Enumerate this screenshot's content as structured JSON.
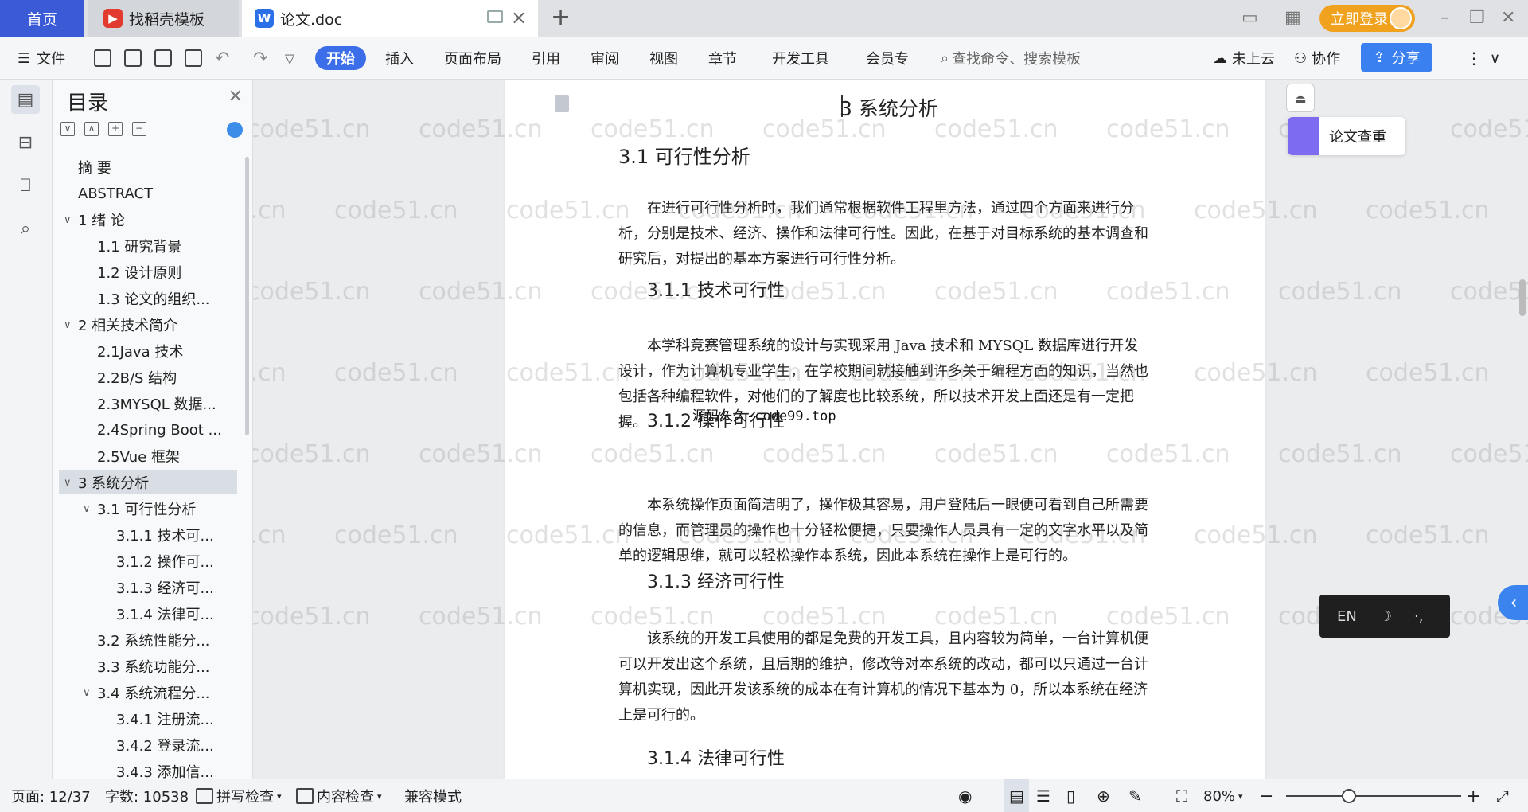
{
  "tabs": {
    "home": "首页",
    "template": "找稻壳模板",
    "doc": "论文.doc",
    "add": "+"
  },
  "account": {
    "login": "立即登录"
  },
  "ribbon": {
    "file": "文件",
    "menus": [
      "开始",
      "插入",
      "页面布局",
      "引用",
      "审阅",
      "视图",
      "章节",
      "开发工具",
      "会员专"
    ],
    "search_placeholder": "查找命令、搜索模板",
    "cloud": "未上云",
    "collab": "协作",
    "share": "分享"
  },
  "toc": {
    "title": "目录",
    "items": [
      {
        "label": "摘 要",
        "level": 1,
        "caret": ""
      },
      {
        "label": "ABSTRACT",
        "level": 1,
        "caret": ""
      },
      {
        "label": "1 绪 论",
        "level": 1,
        "caret": "∨"
      },
      {
        "label": "1.1 研究背景",
        "level": 2,
        "caret": ""
      },
      {
        "label": "1.2 设计原则",
        "level": 2,
        "caret": ""
      },
      {
        "label": "1.3 论文的组织...",
        "level": 2,
        "caret": ""
      },
      {
        "label": "2  相关技术简介",
        "level": 1,
        "caret": "∨"
      },
      {
        "label": "2.1Java 技术",
        "level": 2,
        "caret": ""
      },
      {
        "label": "2.2B/S 结构",
        "level": 2,
        "caret": ""
      },
      {
        "label": "2.3MYSQL 数据...",
        "level": 2,
        "caret": ""
      },
      {
        "label": "2.4Spring Boot ...",
        "level": 2,
        "caret": ""
      },
      {
        "label": "2.5Vue 框架",
        "level": 2,
        "caret": ""
      },
      {
        "label": "3  系统分析",
        "level": 1,
        "caret": "∨"
      },
      {
        "label": "3.1 可行性分析",
        "level": 2,
        "caret": "∨"
      },
      {
        "label": "3.1.1 技术可...",
        "level": 3,
        "caret": ""
      },
      {
        "label": "3.1.2 操作可...",
        "level": 3,
        "caret": ""
      },
      {
        "label": "3.1.3 经济可...",
        "level": 3,
        "caret": ""
      },
      {
        "label": "3.1.4 法律可...",
        "level": 3,
        "caret": ""
      },
      {
        "label": "3.2 系统性能分...",
        "level": 2,
        "caret": ""
      },
      {
        "label": "3.3 系统功能分...",
        "level": 2,
        "caret": ""
      },
      {
        "label": "3.4 系统流程分...",
        "level": 2,
        "caret": "∨"
      },
      {
        "label": "3.4.1 注册流...",
        "level": 3,
        "caret": ""
      },
      {
        "label": "3.4.2 登录流...",
        "level": 3,
        "caret": ""
      },
      {
        "label": "3.4.3 添加信...",
        "level": 3,
        "caret": ""
      }
    ],
    "selected_index": 12
  },
  "document": {
    "h1": "3  系统分析",
    "h2": "3.1 可行性分析",
    "p1": "在进行可行性分析时，我们通常根据软件工程里方法，通过四个方面来进行分析，分别是技术、经济、操作和法律可行性。因此，在基于对目标系统的基本调查和研究后，对提出的基本方案进行可行性分析。",
    "h3_1": "3.1.1 技术可行性",
    "p2": "本学科竞赛管理系统的设计与实现采用 Java 技术和 MYSQL 数据库进行开发设计，作为计算机专业学生，在学校期间就接触到许多关于编程方面的知识，当然也包括各种编程软件，对他们的了解度也比较系统，所以技术开发上面还是有一定把握。",
    "note": "源码久久-code99.top",
    "h3_2": "3.1.2 操作可行性",
    "p3": "本系统操作页面简洁明了，操作极其容易，用户登陆后一眼便可看到自己所需要的信息，而管理员的操作也十分轻松便捷，只要操作人员具有一定的文字水平以及简单的逻辑思维，就可以轻松操作本系统，因此本系统在操作上是可行的。",
    "h3_3": "3.1.3 经济可行性",
    "p4": "该系统的开发工具使用的都是免费的开发工具，且内容较为简单，一台计算机便可以开发出这个系统，且后期的维护，修改等对本系统的改动，都可以只通过一台计算机实现，因此开发该系统的成本在有计算机的情况下基本为 0，所以本系统在经济上是可行的。",
    "h3_4": "3.1.4 法律可行性"
  },
  "side": {
    "check": "论文查重"
  },
  "ime": {
    "lang": "EN",
    "moon": "☽",
    "punct": "·,"
  },
  "watermark": "code51.cn",
  "status": {
    "page": "页面: 12/37",
    "words": "字数: 10538",
    "spell": "拼写检查",
    "content_check": "内容检查",
    "compat": "兼容模式",
    "zoom": "80%"
  }
}
